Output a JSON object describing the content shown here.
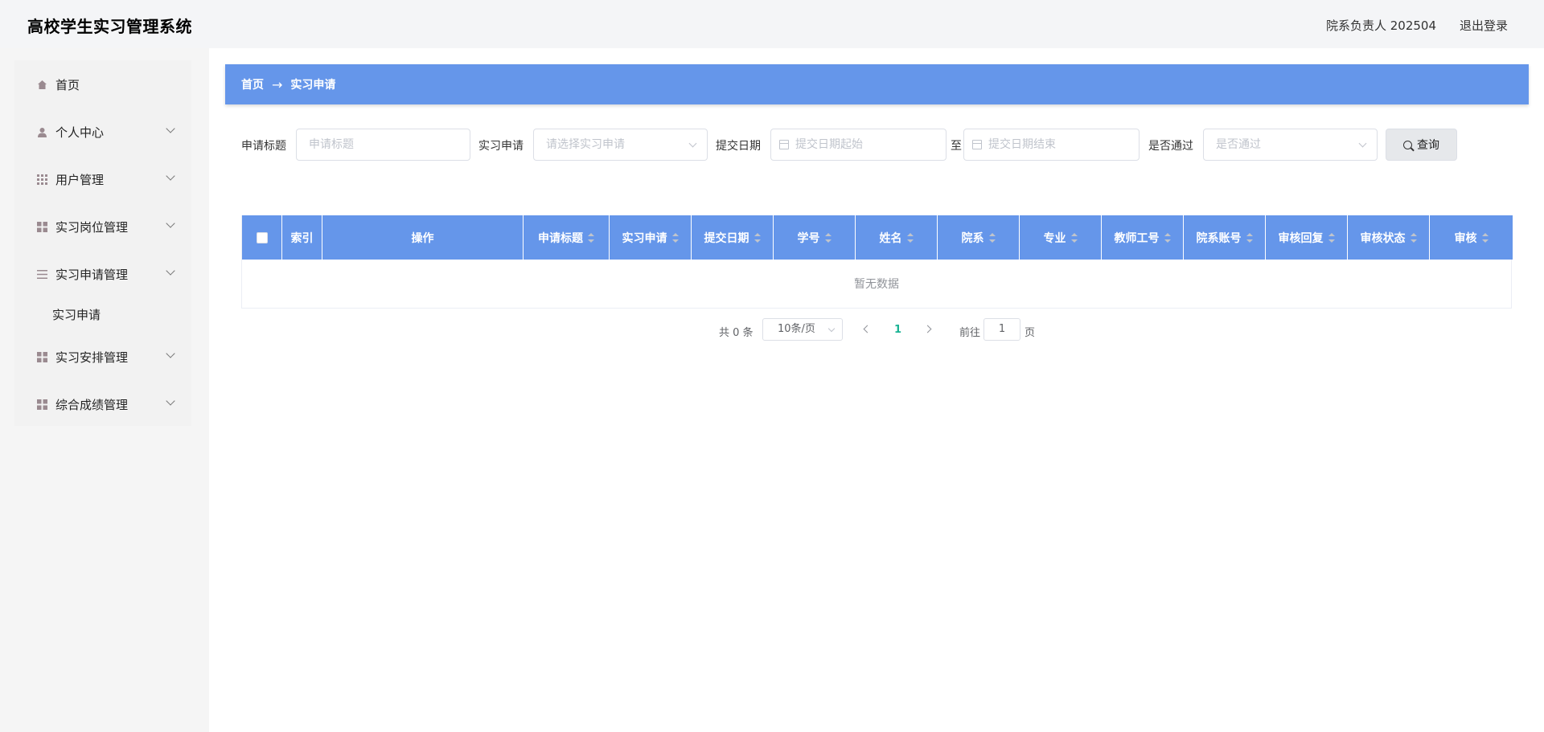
{
  "header": {
    "app_title": "高校学生实习管理系统",
    "user_info": "院系负责人 202504",
    "logout_label": "退出登录"
  },
  "sidebar": {
    "items": [
      {
        "label": "首页",
        "icon": "home-icon"
      },
      {
        "label": "个人中心",
        "icon": "user-icon"
      },
      {
        "label": "用户管理",
        "icon": "grid-icon"
      },
      {
        "label": "实习岗位管理",
        "icon": "apps-icon"
      },
      {
        "label": "实习申请管理",
        "icon": "list-icon"
      },
      {
        "label": "实习安排管理",
        "icon": "apps-icon"
      },
      {
        "label": "综合成绩管理",
        "icon": "apps-icon"
      }
    ],
    "submenu": {
      "label": "实习申请"
    }
  },
  "breadcrumb": {
    "home": "首页",
    "separator": "→",
    "current": "实习申请"
  },
  "search": {
    "title_label": "申请标题",
    "title_placeholder": "申请标题",
    "apply_label": "实习申请",
    "apply_placeholder": "请选择实习申请",
    "date_label": "提交日期",
    "date_start_placeholder": "提交日期起始",
    "date_to": "至",
    "date_end_placeholder": "提交日期结束",
    "pass_label": "是否通过",
    "pass_placeholder": "是否通过",
    "query_label": "查询"
  },
  "table": {
    "columns": [
      "索引",
      "操作",
      "申请标题",
      "实习申请",
      "提交日期",
      "学号",
      "姓名",
      "院系",
      "专业",
      "教师工号",
      "院系账号",
      "审核回复",
      "审核状态",
      "审核"
    ],
    "empty_text": "暂无数据"
  },
  "pagination": {
    "total": "共 0 条",
    "page_size": "10条/页",
    "current_page": "1",
    "goto_label": "前往",
    "goto_value": "1",
    "page_suffix": "页"
  },
  "colors": {
    "accent": "#6596ea",
    "page_active": "#1ab394"
  }
}
